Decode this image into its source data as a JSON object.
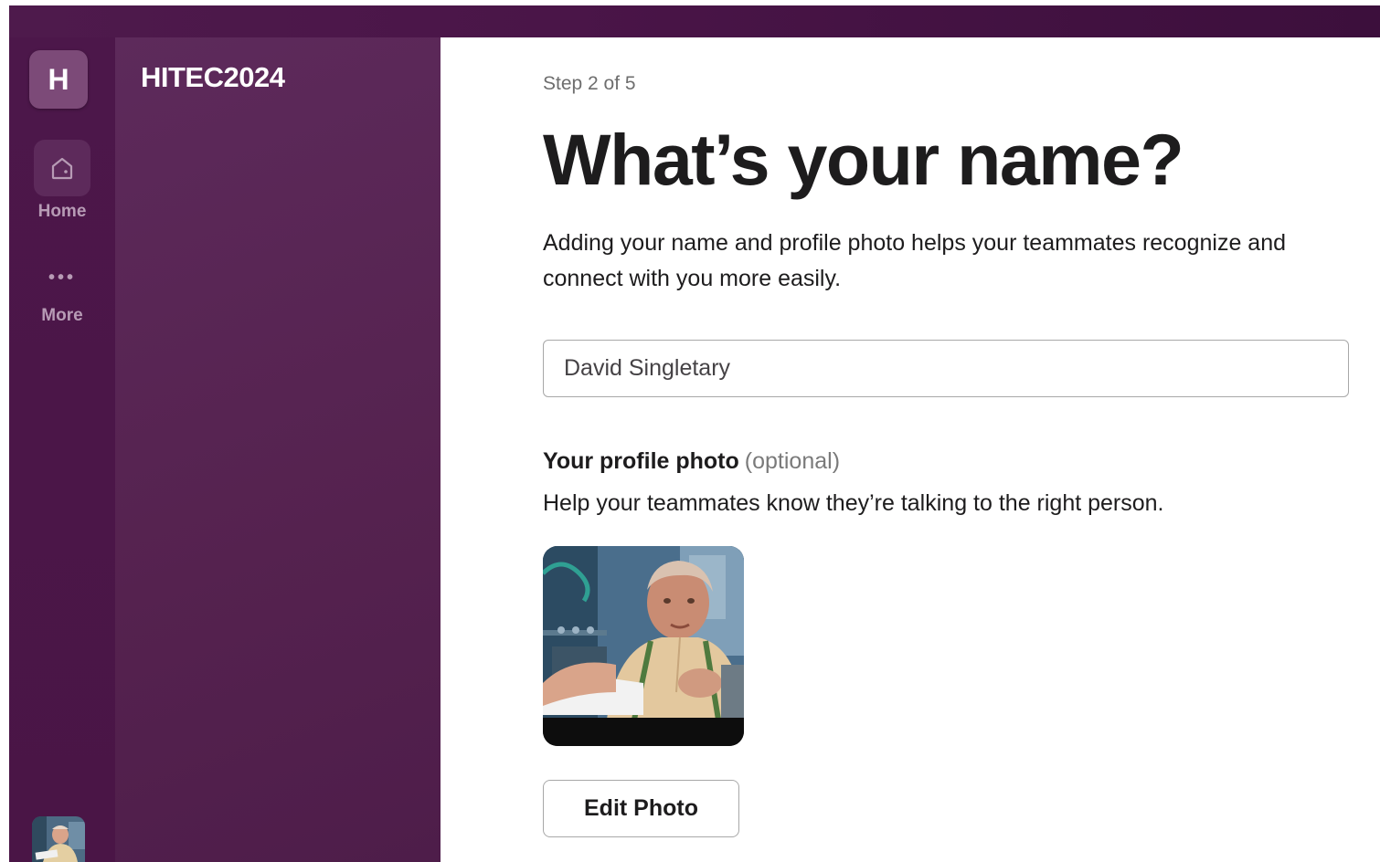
{
  "workspace": {
    "initial": "H",
    "name": "HITEC2024"
  },
  "rail": {
    "home_label": "Home",
    "home_icon": "home-icon",
    "more_label": "More",
    "more_icon": "ellipsis-icon",
    "more_glyph": "•••"
  },
  "onboarding": {
    "step": "Step 2 of 5",
    "title": "What’s your name?",
    "description": "Adding your name and profile photo helps your teammates recognize and connect with you more easily.",
    "name_value": "David Singletary",
    "photo_heading": "Your profile photo",
    "photo_optional": "(optional)",
    "photo_help": "Help your teammates know they’re talking to the right person.",
    "edit_photo_label": "Edit Photo"
  },
  "colors": {
    "aubergine": "#4a1548",
    "sidebar": "#5d2a5b",
    "text": "#1d1c1d"
  }
}
